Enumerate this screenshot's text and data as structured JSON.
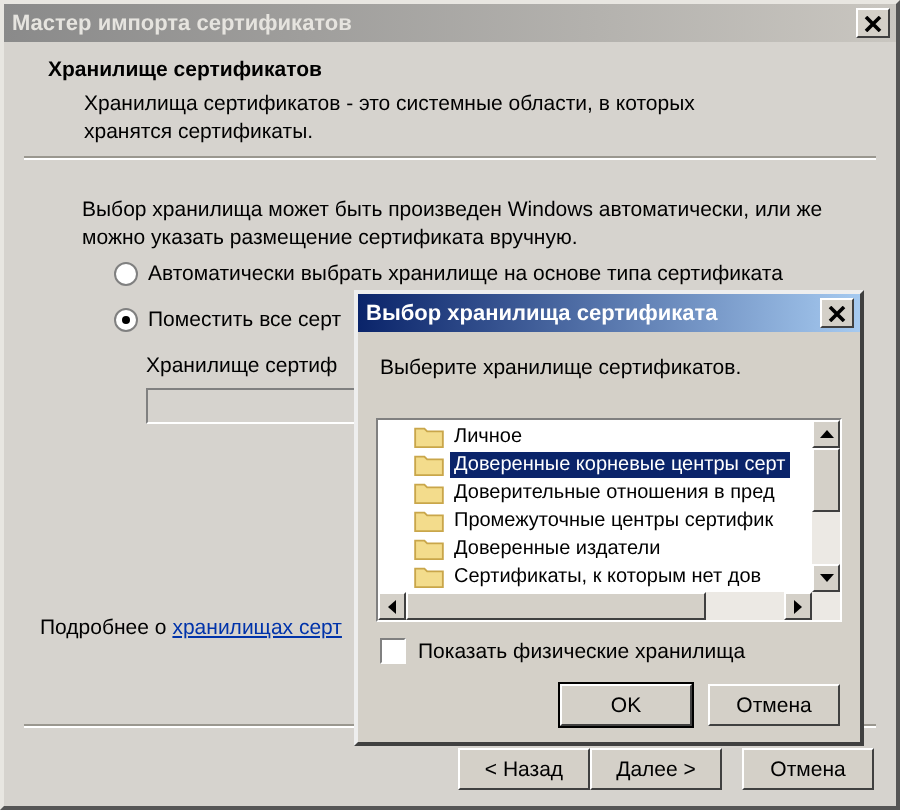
{
  "window": {
    "title": "Мастер импорта сертификатов"
  },
  "header": {
    "title": "Хранилище сертификатов",
    "description": "Хранилища сертификатов - это системные области, в которых хранятся сертификаты."
  },
  "intro": "Выбор хранилища может быть произведен Windows автоматически, или же можно указать размещение сертификата вручную.",
  "options": [
    {
      "label": "Автоматически выбрать хранилище на основе типа сертификата",
      "selected": false
    },
    {
      "label": "Поместить все серт",
      "selected": true
    }
  ],
  "store_field": {
    "label": "Хранилище сертиф"
  },
  "more_info": {
    "text": "Подробнее о",
    "link": "хранилищах серт"
  },
  "buttons": [
    {
      "label": "< Назад"
    },
    {
      "label": "Далее >"
    },
    {
      "label": "Отмена"
    }
  ],
  "dialog": {
    "title": "Выбор хранилища сертификата",
    "prompt": "Выберите хранилище сертификатов.",
    "stores": [
      {
        "label": "Личное",
        "selected": false
      },
      {
        "label": "Доверенные корневые центры серт",
        "selected": true
      },
      {
        "label": "Доверительные отношения в пред",
        "selected": false
      },
      {
        "label": "Промежуточные центры сертифик",
        "selected": false
      },
      {
        "label": "Доверенные издатели",
        "selected": false
      },
      {
        "label": "Сертификаты, к которым нет дов",
        "selected": false
      }
    ],
    "show_physical": {
      "label": "Показать физические хранилища",
      "checked": false
    },
    "buttons": [
      {
        "label": "OK",
        "default": true
      },
      {
        "label": "Отмена",
        "default": false
      }
    ]
  }
}
